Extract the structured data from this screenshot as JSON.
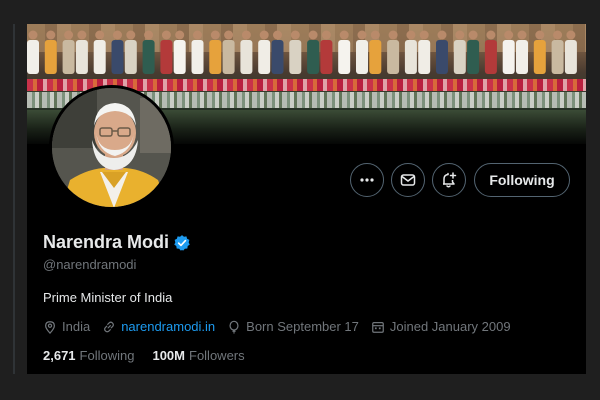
{
  "profile": {
    "name": "Narendra Modi",
    "verified": true,
    "handle": "@narendramodi",
    "bio": "Prime Minister of India",
    "location": "India",
    "website": "narendramodi.in",
    "birthday": "Born September 17",
    "joined": "Joined January 2009",
    "following_count": "2,671",
    "following_label": "Following",
    "followers_count": "100M",
    "followers_label": "Followers"
  },
  "actions": {
    "more_icon": "ellipsis-icon",
    "message_icon": "envelope-icon",
    "notify_icon": "bell-plus-icon",
    "follow_label": "Following"
  },
  "colors": {
    "background": "#000000",
    "text_primary": "#e7e9ea",
    "text_secondary": "#71767b",
    "link": "#1d9bf0",
    "verified_badge": "#1d9bf0",
    "button_border": "#536471"
  }
}
